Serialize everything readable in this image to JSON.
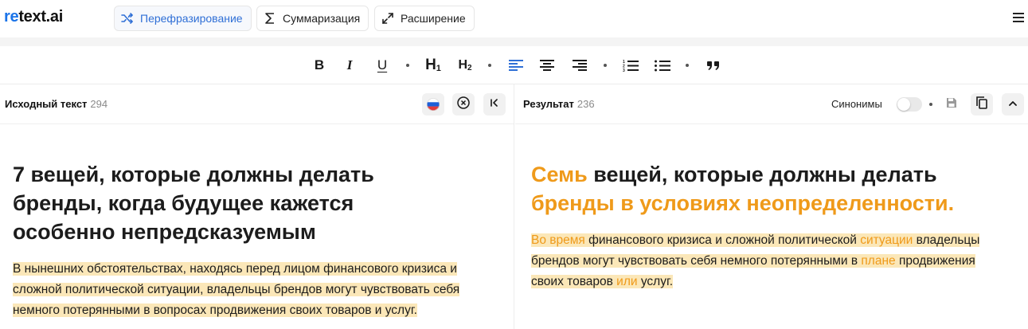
{
  "brand": {
    "logo_re": "re",
    "logo_rest": "text.ai"
  },
  "modes": [
    {
      "label": "Перефразирование",
      "icon": "shuffle-icon",
      "active": true
    },
    {
      "label": "Суммаризация",
      "icon": "sigma-icon",
      "active": false
    },
    {
      "label": "Расширение",
      "icon": "expand-icon",
      "active": false
    }
  ],
  "toolbar": {
    "bold": "B",
    "italic": "I",
    "underline": "U",
    "h1": "H",
    "h1_sub": "1",
    "h2": "H",
    "h2_sub": "2",
    "icons": [
      "bold-icon",
      "italic-icon",
      "underline-icon",
      "heading-1-icon",
      "heading-2-icon",
      "align-left-icon",
      "align-center-icon",
      "align-right-icon",
      "ordered-list-icon",
      "bullet-list-icon",
      "quote-icon"
    ]
  },
  "colors": {
    "accent_blue": "#2f6fd6",
    "highlight": "#fbe7b8",
    "changed_text": "#ef9a1a"
  },
  "source": {
    "title": "Исходный текст",
    "count": "294",
    "headline_lines": [
      "7 вещей, которые должны делать",
      "бренды, когда будущее кажется",
      "особенно непредсказуемым"
    ],
    "para_lines": [
      "В нынешних обстоятельствах, находясь перед лицом финансового кризиса и",
      "сложной политической ситуации, владельцы брендов могут чувствовать себя",
      "немного потерянными в вопросах продвижения своих товаров и услуг."
    ]
  },
  "result": {
    "title": "Результат",
    "count": "236",
    "synonyms_label": "Синонимы",
    "headline": {
      "l1_changed": "Семь",
      "l1_rest": " вещей, которые должны делать",
      "l2_changed": "бренды в условиях неопределенности."
    },
    "para": {
      "s1": "Во время",
      "s2": " финансового кризиса и сложной политической ",
      "s3": "ситуации",
      "s4": " владельцы",
      "s5": "брендов могут чувствовать себя немного потерянными в ",
      "s6": "плане",
      "s7": " продвижения",
      "s8": "своих товаров ",
      "s9": "или",
      "s10": " услуг."
    }
  }
}
